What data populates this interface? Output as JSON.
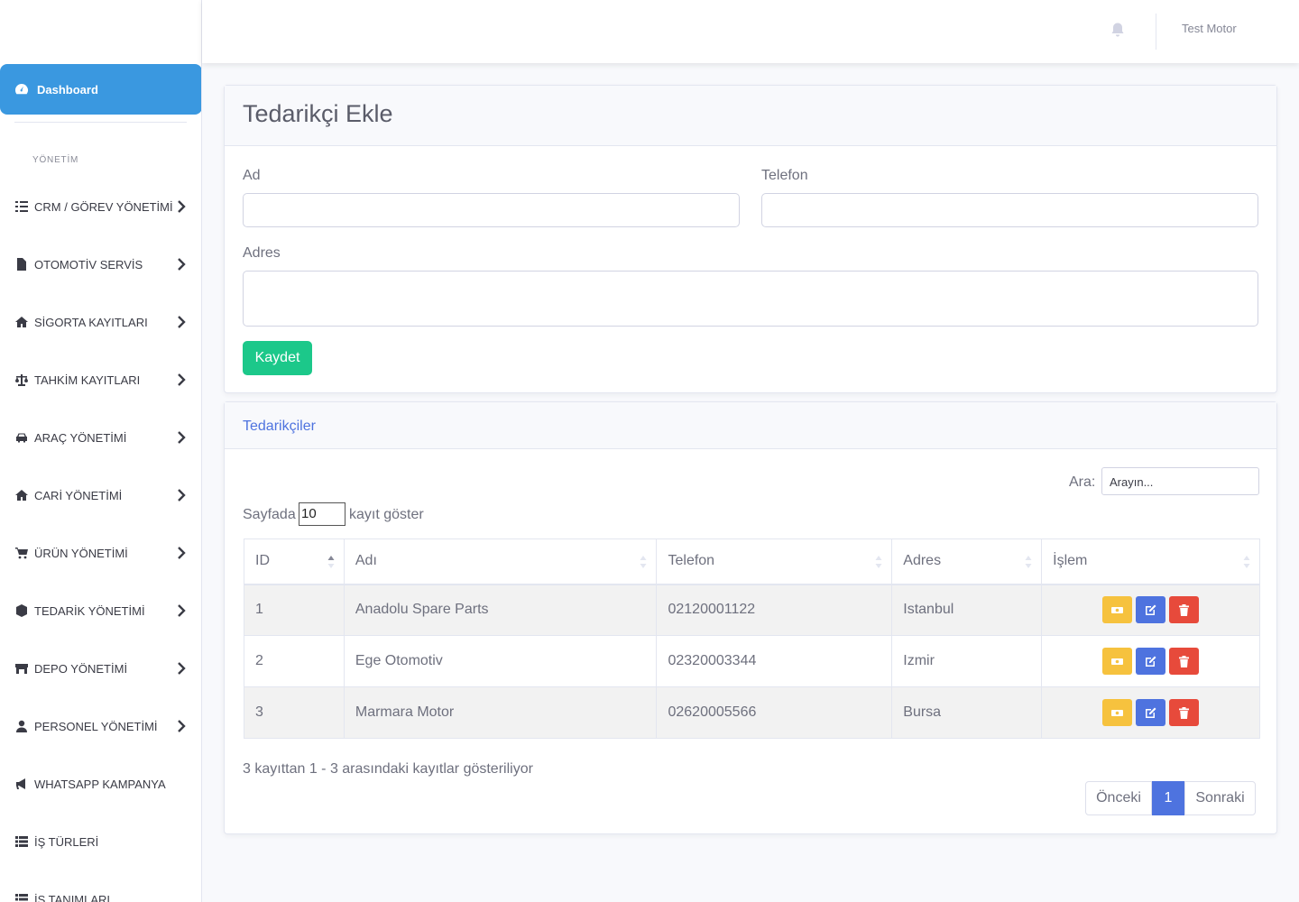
{
  "sidebar": {
    "dashboard_label": "Dashboard",
    "section_heading": "YÖNETİM",
    "items": [
      {
        "label": "CRM / GÖREV YÖNETİMİ",
        "icon": "tasks-icon"
      },
      {
        "label": "OTOMOTİV SERVİS",
        "icon": "file-icon"
      },
      {
        "label": "SİGORTA KAYITLARI",
        "icon": "home-icon"
      },
      {
        "label": "TAHKİM KAYITLARI",
        "icon": "balance-scale-icon"
      },
      {
        "label": "ARAÇ YÖNETİMİ",
        "icon": "car-icon"
      },
      {
        "label": "CARİ YÖNETİMİ",
        "icon": "home-icon"
      },
      {
        "label": "ÜRÜN YÖNETİMİ",
        "icon": "cart-icon"
      },
      {
        "label": "TEDARİK YÖNETİMİ",
        "icon": "box-icon"
      },
      {
        "label": "DEPO YÖNETİMİ",
        "icon": "warehouse-icon"
      },
      {
        "label": "PERSONEL YÖNETİMİ",
        "icon": "user-icon"
      },
      {
        "label": "WHATSAPP KAMPANYA",
        "icon": "megaphone-icon"
      },
      {
        "label": "İŞ TÜRLERİ",
        "icon": "list-icon"
      },
      {
        "label": "İŞ TANIMLARI",
        "icon": "list-icon"
      }
    ]
  },
  "topbar": {
    "user_name": "Test Motor"
  },
  "form": {
    "title": "Tedarikçi Ekle",
    "name_label": "Ad",
    "phone_label": "Telefon",
    "address_label": "Adres",
    "name_value": "",
    "phone_value": "",
    "address_value": "",
    "save_label": "Kaydet"
  },
  "table_card": {
    "title": "Tedarikçiler",
    "search_label": "Ara:",
    "search_placeholder": "Arayın...",
    "length_prefix": "Sayfada",
    "length_value": "10",
    "length_suffix": "kayıt göster",
    "columns": [
      "ID",
      "Adı",
      "Telefon",
      "Adres",
      "İşlem"
    ],
    "rows": [
      {
        "id": "1",
        "name": "Anadolu Spare Parts",
        "phone": "02120001122",
        "address": "Istanbul"
      },
      {
        "id": "2",
        "name": "Ege Otomotiv",
        "phone": "02320003344",
        "address": "Izmir"
      },
      {
        "id": "3",
        "name": "Marmara Motor",
        "phone": "02620005566",
        "address": "Bursa"
      }
    ],
    "info": "3 kayıttan 1 - 3 arasındaki kayıtlar gösteriliyor",
    "prev_label": "Önceki",
    "current_page": "1",
    "next_label": "Sonraki"
  },
  "colors": {
    "primary": "#4e73df",
    "sidebar_active": "#3a98e0",
    "success": "#1cc88a",
    "warning": "#f6c23e",
    "danger": "#e74a3b"
  }
}
